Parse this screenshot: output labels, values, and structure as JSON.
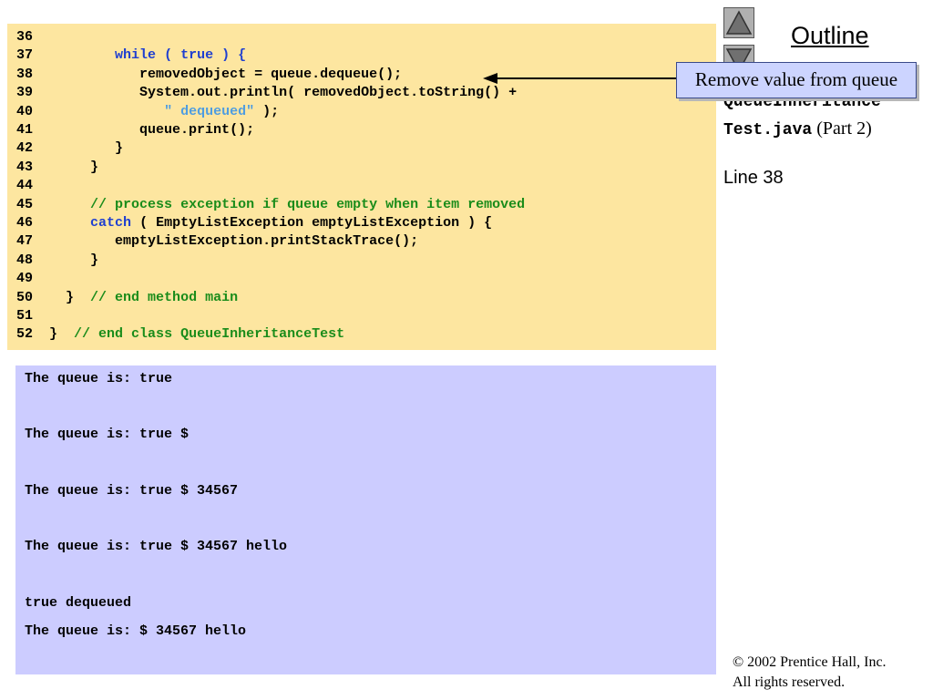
{
  "code_lines": [
    {
      "n": "36",
      "segs": []
    },
    {
      "n": "37",
      "segs": [
        {
          "t": "        ",
          "c": "tx"
        },
        {
          "t": "while",
          "c": "kw"
        },
        {
          "t": " ( ",
          "c": "kw"
        },
        {
          "t": "true",
          "c": "kw"
        },
        {
          "t": " ) {",
          "c": "kw"
        }
      ]
    },
    {
      "n": "38",
      "segs": [
        {
          "t": "           removedObject = queue.dequeue();",
          "c": "tx"
        }
      ]
    },
    {
      "n": "39",
      "segs": [
        {
          "t": "           System.out.println( removedObject.toString() +",
          "c": "tx"
        }
      ]
    },
    {
      "n": "40",
      "segs": [
        {
          "t": "              ",
          "c": "tx"
        },
        {
          "t": "\" dequeued\"",
          "c": "str"
        },
        {
          "t": " );",
          "c": "tx"
        }
      ]
    },
    {
      "n": "41",
      "segs": [
        {
          "t": "           queue.print();",
          "c": "tx"
        }
      ]
    },
    {
      "n": "42",
      "segs": [
        {
          "t": "        }",
          "c": "tx"
        }
      ]
    },
    {
      "n": "43",
      "segs": [
        {
          "t": "     }",
          "c": "tx"
        }
      ]
    },
    {
      "n": "44",
      "segs": []
    },
    {
      "n": "45",
      "segs": [
        {
          "t": "     ",
          "c": "tx"
        },
        {
          "t": "// process exception if queue empty when item removed",
          "c": "cm"
        }
      ]
    },
    {
      "n": "46",
      "segs": [
        {
          "t": "     ",
          "c": "tx"
        },
        {
          "t": "catch",
          "c": "kw"
        },
        {
          "t": " ( EmptyListException emptyListException ) {",
          "c": "tx"
        }
      ]
    },
    {
      "n": "47",
      "segs": [
        {
          "t": "        emptyListException.printStackTrace();",
          "c": "tx"
        }
      ]
    },
    {
      "n": "48",
      "segs": [
        {
          "t": "     }",
          "c": "tx"
        }
      ]
    },
    {
      "n": "49",
      "segs": []
    },
    {
      "n": "50",
      "segs": [
        {
          "t": "  }  ",
          "c": "tx"
        },
        {
          "t": "// end method main",
          "c": "cm"
        }
      ]
    },
    {
      "n": "51",
      "segs": []
    },
    {
      "n": "52",
      "segs": [
        {
          "t": "}  ",
          "c": "tx"
        },
        {
          "t": "// end class QueueInheritanceTest",
          "c": "cm"
        }
      ]
    }
  ],
  "output_lines": [
    "The queue is: true",
    "The queue is: true $",
    "The queue is: true $ 34567",
    "The queue is: true $ 34567 hello",
    "true dequeued",
    "The queue is: $ 34567 hello"
  ],
  "sidebar": {
    "outline_title": "Outline",
    "callout": "Remove value from queue",
    "file_line1": "QueueInheritance",
    "file_line2": "Test.java",
    "file_part": " (Part 2)",
    "line_ref": "Line 38"
  },
  "icons": {
    "up": "up-arrow-icon",
    "down": "down-arrow-icon"
  },
  "footer": {
    "copyright_line1": "© 2002 Prentice Hall, Inc.",
    "copyright_line2": "All rights reserved."
  }
}
